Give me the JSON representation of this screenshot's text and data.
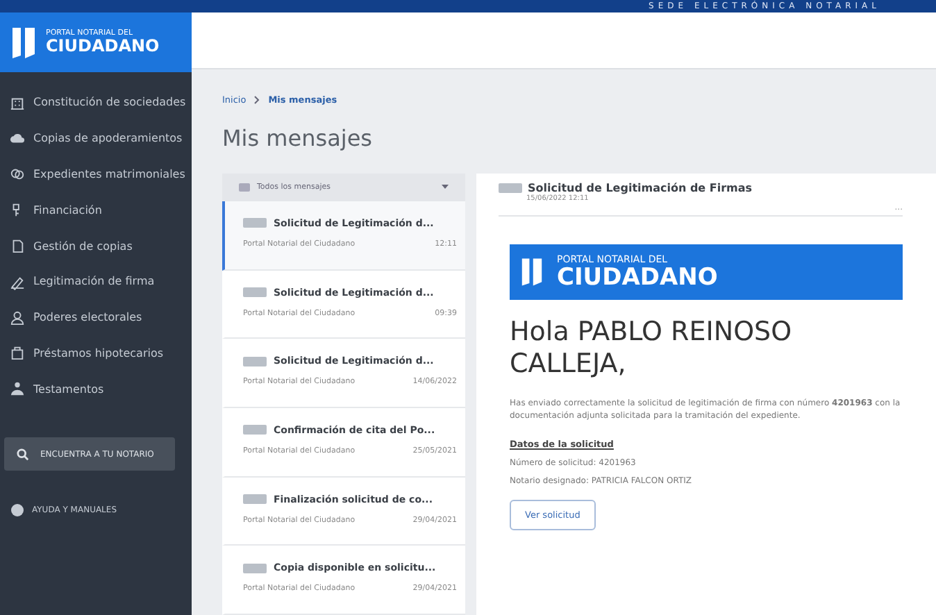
{
  "top_banner": {
    "title": "SEDE ELECTRÓNICA NOTARIAL"
  },
  "logo": {
    "small": "PORTAL NOTARIAL DEL",
    "big": "CIUDADANO"
  },
  "sidebar": {
    "items": [
      {
        "label": "Constitución de sociedades",
        "kind": "building"
      },
      {
        "label": "Copias de apoderamientos",
        "kind": "cloud"
      },
      {
        "label": "Expedientes matrimoniales",
        "kind": "rings"
      },
      {
        "label": "Financiación",
        "kind": "key"
      },
      {
        "label": "Gestión de copias",
        "kind": "copy"
      },
      {
        "label": "Legitimación de firma",
        "kind": "pen"
      },
      {
        "label": "Poderes electorales",
        "kind": "person"
      },
      {
        "label": "Préstamos hipotecarios",
        "kind": "case"
      },
      {
        "label": "Testamentos",
        "kind": "group"
      }
    ],
    "search_button": "ENCUENTRA A TU NOTARIO",
    "help": "AYUDA Y MANUALES"
  },
  "breadcrumb": [
    {
      "label": "Inicio",
      "selected": false
    },
    {
      "label": "Mis mensajes",
      "selected": true
    }
  ],
  "page_title": "Mis mensajes",
  "filter": {
    "value": "Todos los mensajes"
  },
  "messages": [
    {
      "subject": "Solicitud de Legitimación d...",
      "sender": "Portal Notarial del Ciudadano",
      "date": "12:11",
      "selected": true
    },
    {
      "subject": "Solicitud de Legitimación d...",
      "sender": "Portal Notarial del Ciudadano",
      "date": "09:39",
      "selected": false
    },
    {
      "subject": "Solicitud de Legitimación d...",
      "sender": "Portal Notarial del Ciudadano",
      "date": "14/06/2022",
      "selected": false
    },
    {
      "subject": "Confirmación de cita del Po...",
      "sender": "Portal Notarial del Ciudadano",
      "date": "25/05/2021",
      "selected": false
    },
    {
      "subject": "Finalización solicitud de co...",
      "sender": "Portal Notarial del Ciudadano",
      "date": "29/04/2021",
      "selected": false
    },
    {
      "subject": "Copia disponible en solicitu...",
      "sender": "Portal Notarial del Ciudadano",
      "date": "29/04/2021",
      "selected": false
    }
  ],
  "detail": {
    "subject": "Solicitud de Legitimación de Firmas",
    "date": "15/06/2022 12:11",
    "more": "...",
    "logo_small": "PORTAL NOTARIAL DEL",
    "logo_big": "CIUDADANO",
    "greeting": "Hola PABLO REINOSO CALLEJA,",
    "body": "Has enviado correctamente la solicitud de legitimación de firma con número **4201963** con la documentación adjunta solicitada para la tramitación del expediente.",
    "section_title": "Datos de la solicitud",
    "fields": [
      "Número de solicitud: 4201963",
      "Notario designado: PATRICIA FALCON ORTIZ"
    ],
    "button": "Ver solicitud"
  }
}
